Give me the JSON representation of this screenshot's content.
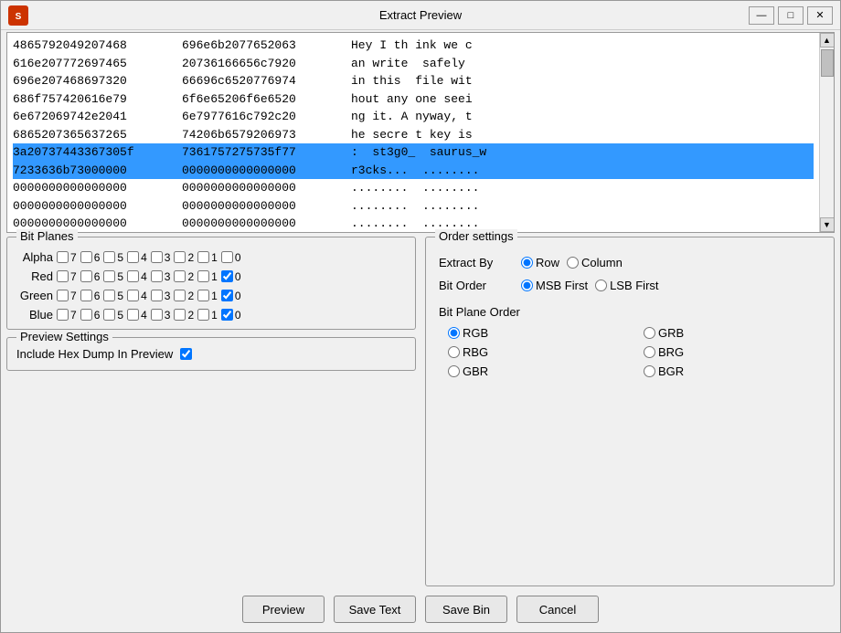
{
  "window": {
    "title": "Extract Preview",
    "icon": "🔴",
    "controls": {
      "minimize": "—",
      "maximize": "□",
      "close": "✕"
    }
  },
  "preview": {
    "lines": [
      {
        "col1": "4865792049207468",
        "col2": "696e6b2077652063",
        "col3": "Hey I th ink we c"
      },
      {
        "col1": "616e207772697465",
        "col2": "20736166656c7920",
        "col3": "an write  safely"
      },
      {
        "col1": "696e207468697320",
        "col2": "66696c6520776974",
        "col3": "in this  file wit"
      },
      {
        "col1": "686f757420616e79",
        "col2": "6f6e65206f6e6520",
        "col3": "hout any one seei"
      },
      {
        "col1": "6e672069742e2041",
        "col2": "6e7977616c792c20",
        "col3": "ng it. A nyway, t"
      },
      {
        "col1": "6865207365637265",
        "col2": "74206b6579206973",
        "col3": "he secre t key is"
      },
      {
        "col1": "3a20737443367305f",
        "col2": "7361757275735f77",
        "col3": ":  st3g0_  saurus_w",
        "highlight": true
      },
      {
        "col1": "7233636b73000000",
        "col2": "0000000000000000",
        "col3": "r3cks...  ........",
        "highlight": true
      },
      {
        "col1": "0000000000000000",
        "col2": "0000000000000000",
        "col3": "........  ........"
      },
      {
        "col1": "0000000000000000",
        "col2": "0000000000000000",
        "col3": "........  ........"
      },
      {
        "col1": "0000000000000000",
        "col2": "0000000000000000",
        "col3": "........  ........"
      }
    ]
  },
  "bitPlanes": {
    "title": "Bit Planes",
    "rows": [
      {
        "label": "Alpha",
        "bits": [
          {
            "num": 7,
            "checked": false
          },
          {
            "num": 6,
            "checked": false
          },
          {
            "num": 5,
            "checked": false
          },
          {
            "num": 4,
            "checked": false
          },
          {
            "num": 3,
            "checked": false
          },
          {
            "num": 2,
            "checked": false
          },
          {
            "num": 1,
            "checked": false
          },
          {
            "num": 0,
            "checked": false
          }
        ]
      },
      {
        "label": "Red",
        "bits": [
          {
            "num": 7,
            "checked": false
          },
          {
            "num": 6,
            "checked": false
          },
          {
            "num": 5,
            "checked": false
          },
          {
            "num": 4,
            "checked": false
          },
          {
            "num": 3,
            "checked": false
          },
          {
            "num": 2,
            "checked": false
          },
          {
            "num": 1,
            "checked": false
          },
          {
            "num": 0,
            "checked": true
          }
        ]
      },
      {
        "label": "Green",
        "bits": [
          {
            "num": 7,
            "checked": false
          },
          {
            "num": 6,
            "checked": false
          },
          {
            "num": 5,
            "checked": false
          },
          {
            "num": 4,
            "checked": false
          },
          {
            "num": 3,
            "checked": false
          },
          {
            "num": 2,
            "checked": false
          },
          {
            "num": 1,
            "checked": false
          },
          {
            "num": 0,
            "checked": true
          }
        ]
      },
      {
        "label": "Blue",
        "bits": [
          {
            "num": 7,
            "checked": false
          },
          {
            "num": 6,
            "checked": false
          },
          {
            "num": 5,
            "checked": false
          },
          {
            "num": 4,
            "checked": false
          },
          {
            "num": 3,
            "checked": false
          },
          {
            "num": 2,
            "checked": false
          },
          {
            "num": 1,
            "checked": false
          },
          {
            "num": 0,
            "checked": true
          }
        ]
      }
    ]
  },
  "orderSettings": {
    "title": "Order settings",
    "extractBy": {
      "label": "Extract By",
      "options": [
        "Row",
        "Column"
      ],
      "selected": "Row"
    },
    "bitOrder": {
      "label": "Bit Order",
      "options": [
        "MSB First",
        "LSB First"
      ],
      "selected": "MSB First"
    },
    "bitPlaneOrder": {
      "label": "Bit Plane Order",
      "options": [
        {
          "value": "RGB",
          "selected": true
        },
        {
          "value": "GRB",
          "selected": false
        },
        {
          "value": "RBG",
          "selected": false
        },
        {
          "value": "BRG",
          "selected": false
        },
        {
          "value": "GBR",
          "selected": false
        },
        {
          "value": "BGR",
          "selected": false
        }
      ]
    }
  },
  "previewSettings": {
    "title": "Preview Settings",
    "includeHexDump": {
      "label": "Include Hex Dump In Preview",
      "checked": true
    }
  },
  "buttons": {
    "preview": "Preview",
    "saveText": "Save Text",
    "saveBin": "Save Bin",
    "cancel": "Cancel"
  }
}
